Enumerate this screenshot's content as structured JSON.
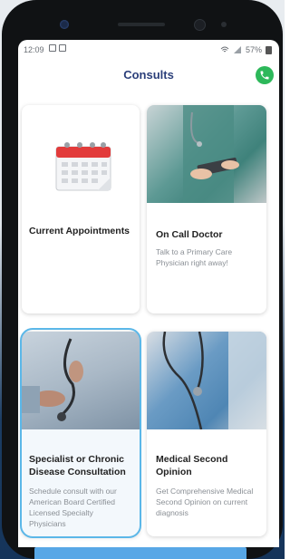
{
  "status_bar": {
    "time": "12:09",
    "battery": "57%"
  },
  "header": {
    "title": "Consults",
    "phone_icon": "phone-icon",
    "accent_color": "#2db85a"
  },
  "cards": [
    {
      "title": "Current Appointments",
      "description": "",
      "icon": "calendar-icon"
    },
    {
      "title": "On Call Doctor",
      "description": "Talk to a Primary Care Physician right away!",
      "icon": "doctor-photo"
    },
    {
      "title": "Specialist or Chronic Disease Consultation",
      "description": "Schedule consult with our American Board Certified Licensed Specialty Physicians",
      "icon": "stethoscope-photo",
      "selected": true
    },
    {
      "title": "Medical Second Opinion",
      "description": "Get Comprehensive Medical Second Opinion on current diagnosis",
      "icon": "doctor-stethoscope-photo"
    }
  ],
  "colors": {
    "title_text": "#2b3f7a",
    "selection_ring": "#5bb7e8"
  }
}
